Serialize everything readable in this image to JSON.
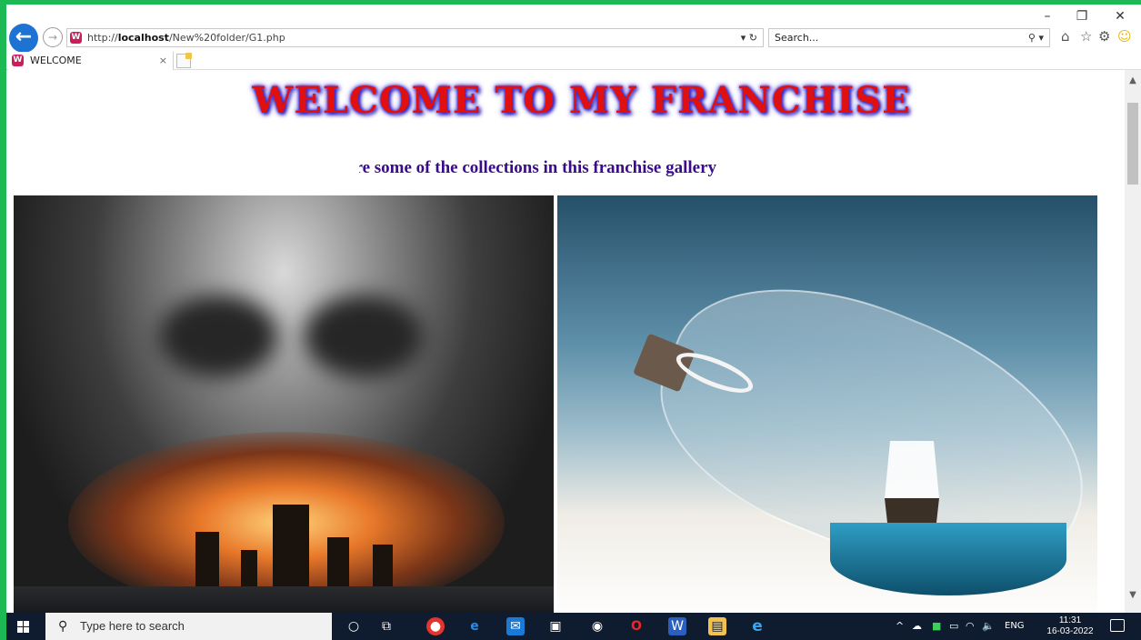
{
  "browser": {
    "window_controls": {
      "minimize": "–",
      "restore": "❐",
      "close": "✕"
    },
    "address": {
      "url_prefix": "http://",
      "url_host": "localhost",
      "url_path": "/New%20folder/G1.php",
      "tools": "▾ ↻"
    },
    "search": {
      "placeholder": "Search...",
      "icon": "⚲ ▾"
    },
    "toolbar_icons": [
      "home-icon",
      "star-icon",
      "gear-icon",
      "smiley-icon"
    ],
    "tab": {
      "title": "WELCOME",
      "close": "×"
    },
    "site_icon_letter": "W"
  },
  "page": {
    "title": "WELCOME TO MY FRANCHISE",
    "subtitle": "are some of the collections in this franchise gallery",
    "images": [
      {
        "name": "pirate-skull-fleet-image",
        "desc_icon": "image"
      },
      {
        "name": "ship-in-bottle-image",
        "desc_icon": "image"
      }
    ]
  },
  "taskbar": {
    "search_placeholder": "Type here to search",
    "tray": {
      "lang": "ENG",
      "time": "11:31",
      "date": "16-03-2022"
    },
    "colors": {
      "background": "#0f1b2e"
    }
  }
}
